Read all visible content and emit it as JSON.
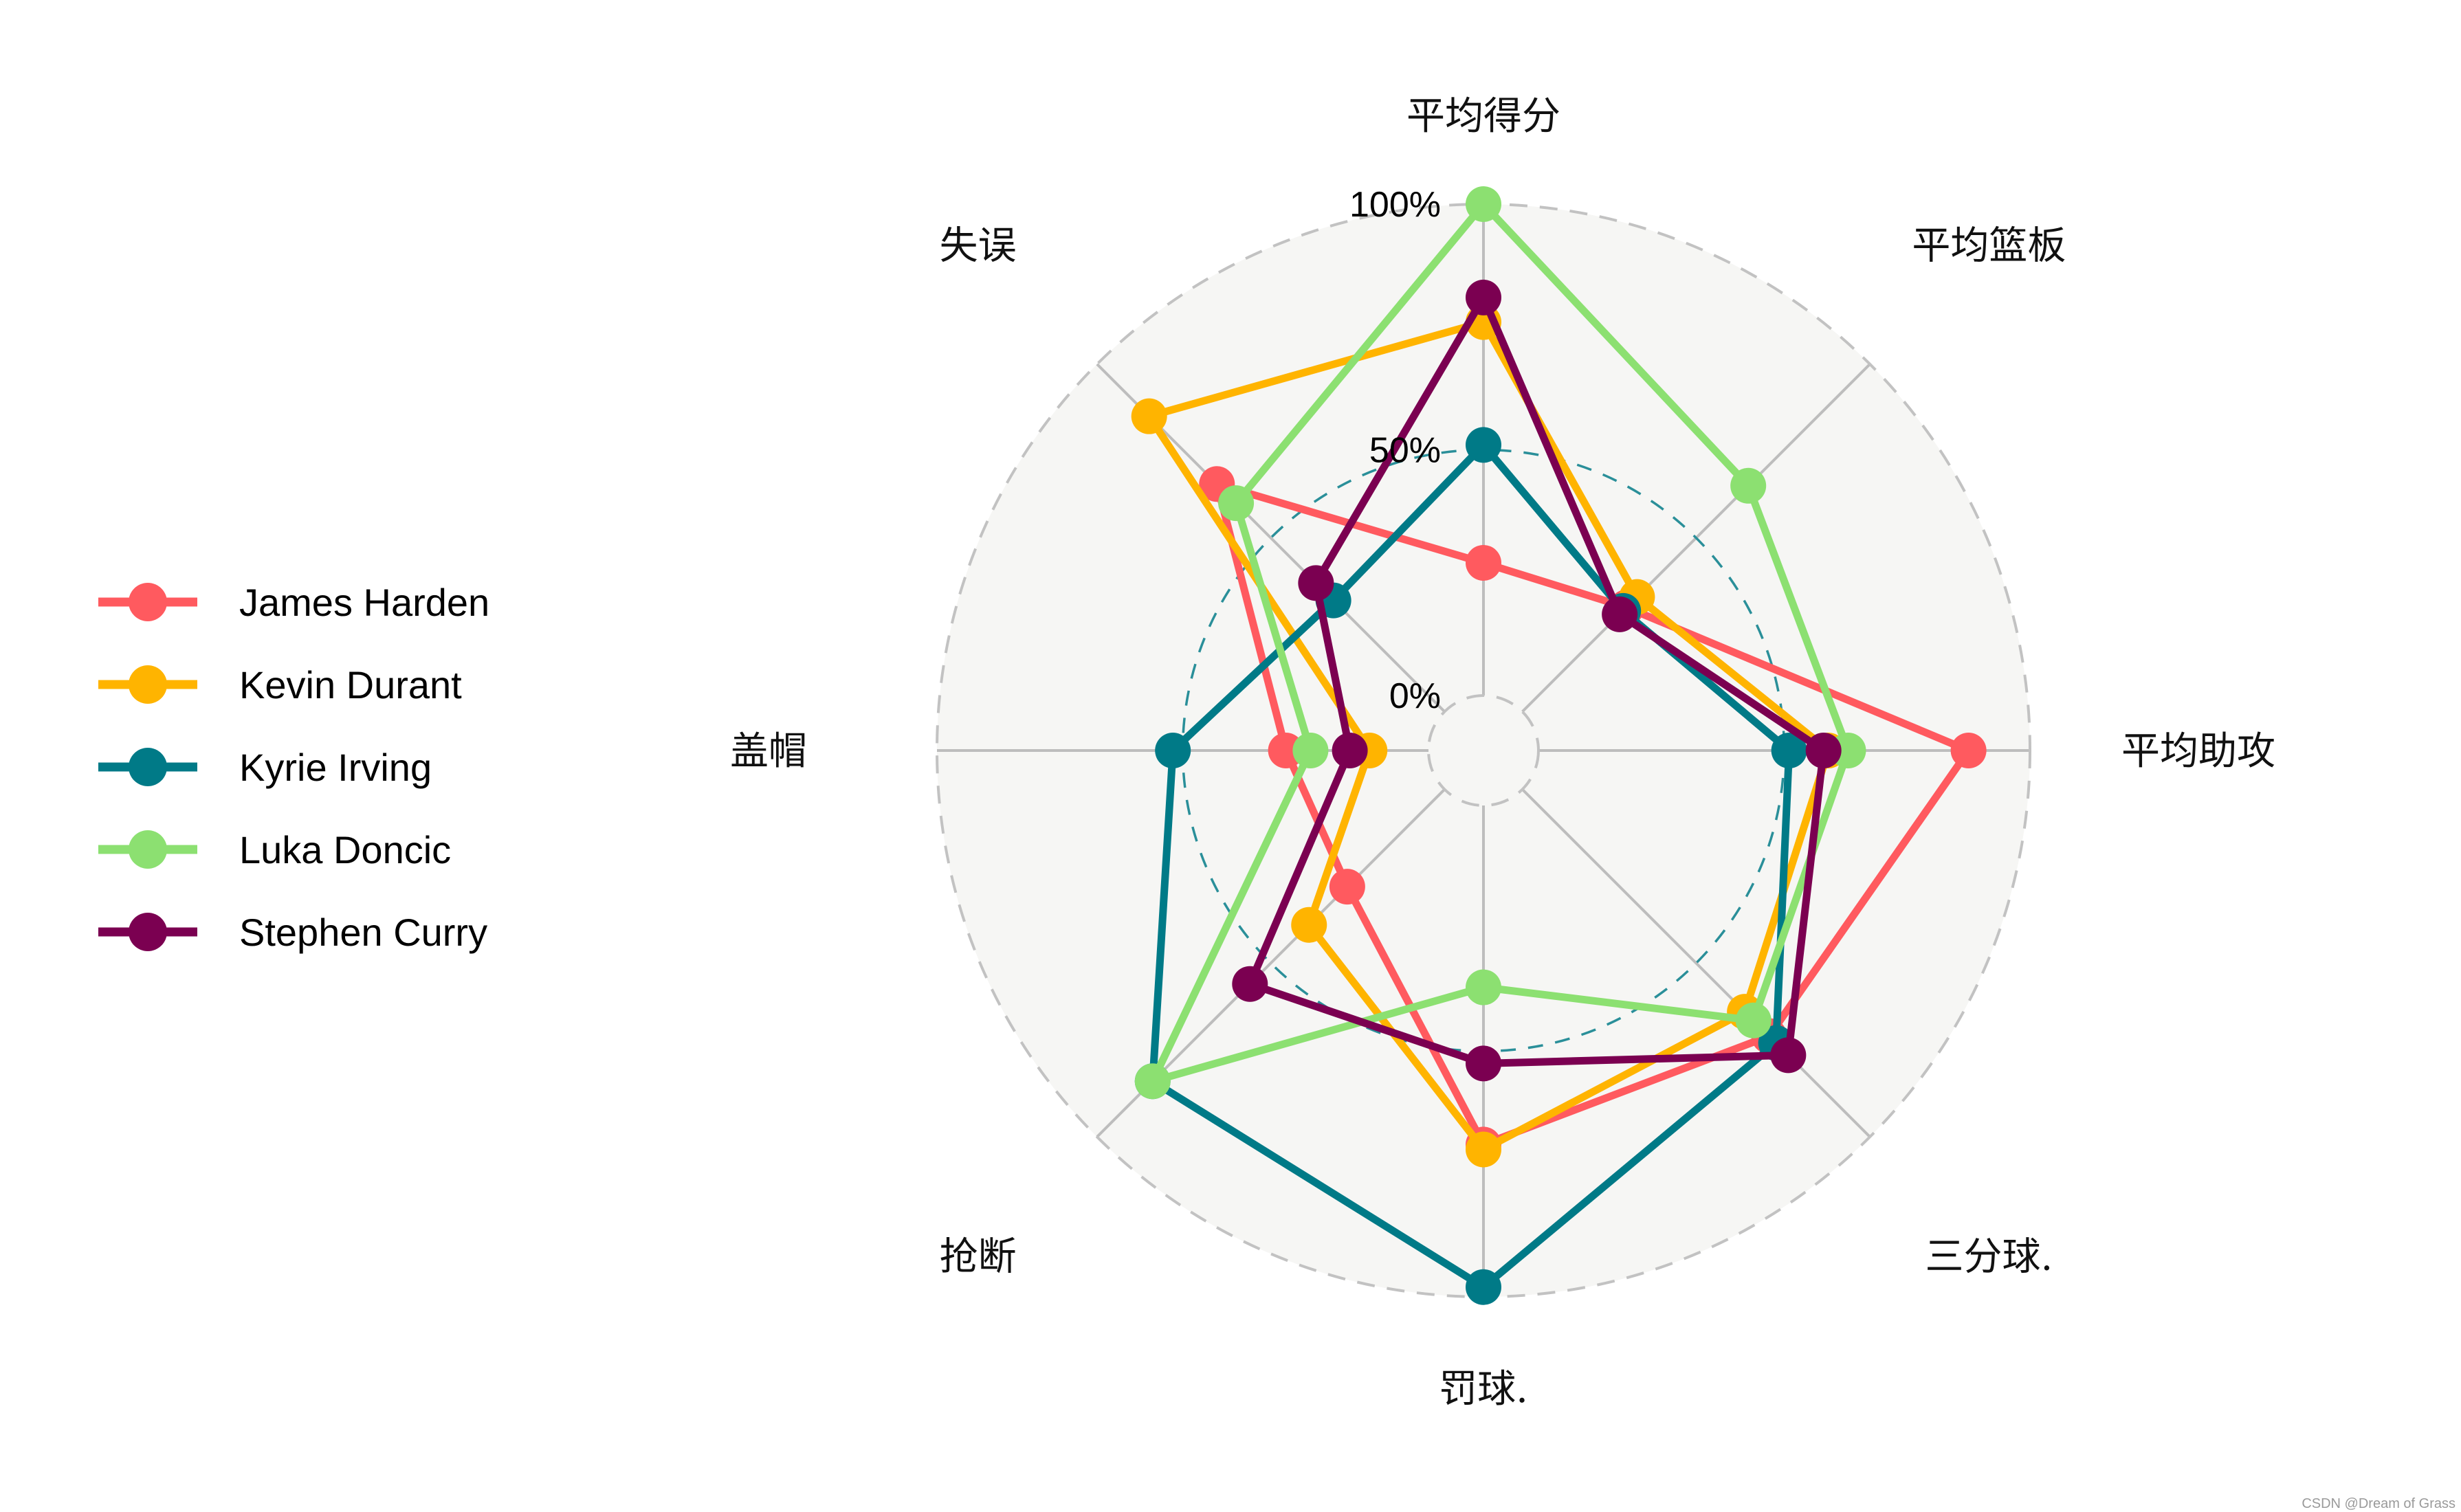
{
  "chart_data": {
    "type": "radar",
    "title": "",
    "axes": [
      "平均得分",
      "平均篮板",
      "平均助攻",
      "三分球.",
      "罚球.",
      "抢断",
      "盖帽",
      "失误"
    ],
    "range": [
      0,
      1
    ],
    "gridlines": [
      {
        "value": 0,
        "label": "0%"
      },
      {
        "value": 0.5,
        "label": "50%"
      },
      {
        "value": 1,
        "label": "100%"
      }
    ],
    "legend_position": "left",
    "series": [
      {
        "name": "James Harden",
        "color": "#FF5A5F",
        "values": [
          0.27,
          0.3,
          0.875,
          0.71,
          0.69,
          0.28,
          0.29,
          0.655
        ]
      },
      {
        "name": "Kevin Durant",
        "color": "#FFB400",
        "values": [
          0.76,
          0.33,
          0.59,
          0.64,
          0.7,
          0.39,
          0.12,
          0.85
        ]
      },
      {
        "name": "Kyrie Irving",
        "color": "#007A87",
        "values": [
          0.51,
          0.29,
          0.51,
          0.73,
          0.98,
          0.84,
          0.52,
          0.32
        ]
      },
      {
        "name": "Luka Doncic",
        "color": "#8CE071",
        "values": [
          1.0,
          0.65,
          0.63,
          0.665,
          0.37,
          0.84,
          0.24,
          0.6
        ]
      },
      {
        "name": "Stephen Curry",
        "color": "#7B0051",
        "values": [
          0.81,
          0.28,
          0.58,
          0.765,
          0.525,
          0.56,
          0.16,
          0.37
        ]
      }
    ]
  },
  "watermark": "CSDN @Dream of Grass"
}
